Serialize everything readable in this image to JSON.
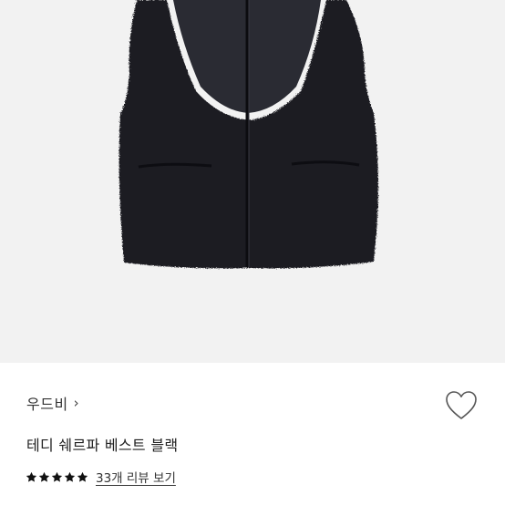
{
  "product": {
    "brand": "우드비",
    "brand_chevron": "›",
    "title": "테디 쉐르파 베스트 블랙",
    "rating_stars": 5,
    "review_link": "33개 리뷰 보기",
    "icons": {
      "favorite": "heart-outline-icon",
      "star": "star-icon"
    },
    "colors": {
      "star": "#111111",
      "heart_outline": "#555555",
      "photo_bg": "#f2f2f2"
    }
  }
}
